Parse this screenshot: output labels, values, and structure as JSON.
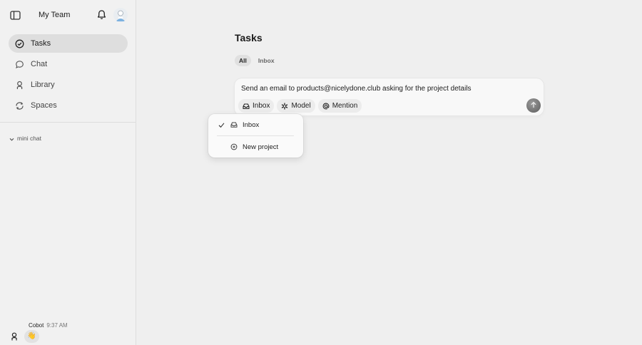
{
  "sidebar": {
    "team_name": "My Team",
    "nav": [
      {
        "label": "Tasks",
        "icon": "check-circle-icon",
        "active": true
      },
      {
        "label": "Chat",
        "icon": "chat-bubble-icon",
        "active": false
      },
      {
        "label": "Library",
        "icon": "person-icon",
        "active": false
      },
      {
        "label": "Spaces",
        "icon": "sync-icon",
        "active": false
      }
    ],
    "mini_chat_label": "mini chat",
    "footer": {
      "sender": "Cobot",
      "time": "9:37 AM",
      "reaction": "👋"
    }
  },
  "main": {
    "title": "Tasks",
    "tabs": [
      {
        "label": "All",
        "active": true
      },
      {
        "label": "Inbox",
        "active": false
      }
    ],
    "composer": {
      "text": "Send an email to products@nicelydone.club asking for the project details",
      "chips": [
        {
          "label": "Inbox",
          "icon": "inbox-icon"
        },
        {
          "label": "Model",
          "icon": "asterisk-icon"
        },
        {
          "label": "Mention",
          "icon": "at-icon"
        }
      ],
      "send_icon": "arrow-up-icon"
    },
    "dropdown": {
      "items": [
        {
          "label": "Inbox",
          "icon": "inbox-icon",
          "checked": true
        },
        {
          "label": "New project",
          "icon": "plus-circle-icon",
          "checked": false
        }
      ]
    }
  }
}
